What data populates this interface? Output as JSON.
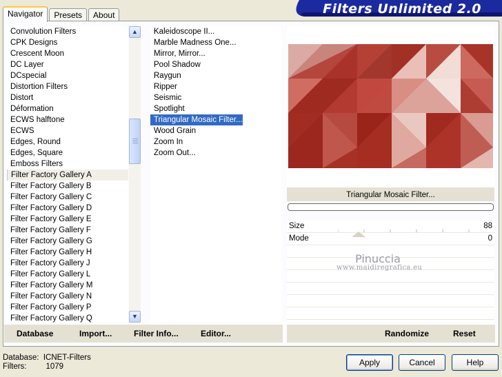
{
  "tabs": [
    "Navigator",
    "Presets",
    "About"
  ],
  "banner_title": "Filters Unlimited 2.0",
  "categories": [
    "Convolution Filters",
    "CPK Designs",
    "Crescent Moon",
    "DC Layer",
    "DCspecial",
    "Distortion Filters",
    "Distort",
    "Déformation",
    "ECWS halftone",
    "ECWS",
    "Edges, Round",
    "Edges, Square",
    "Emboss Filters",
    "Filter Factory Gallery A",
    "Filter Factory Gallery B",
    "Filter Factory Gallery C",
    "Filter Factory Gallery D",
    "Filter Factory Gallery E",
    "Filter Factory Gallery F",
    "Filter Factory Gallery G",
    "Filter Factory Gallery H",
    "Filter Factory Gallery J",
    "Filter Factory Gallery L",
    "Filter Factory Gallery M",
    "Filter Factory Gallery N",
    "Filter Factory Gallery P",
    "Filter Factory Gallery Q"
  ],
  "selected_category": "Filter Factory Gallery A",
  "filters": [
    "Kaleidoscope II...",
    "Marble Madness One...",
    "Mirror, Mirror...",
    "Pool Shadow",
    "Raygun",
    "Ripper",
    "Seismic",
    "Spotlight",
    "Triangular Mosaic Filter...",
    "Wood Grain",
    "Zoom In",
    "Zoom Out..."
  ],
  "selected_filter": "Triangular Mosaic Filter...",
  "preview": {
    "filter_name": "Triangular Mosaic Filter..."
  },
  "params": [
    {
      "label": "Size",
      "value": "88"
    },
    {
      "label": "Mode",
      "value": "0"
    }
  ],
  "watermark": {
    "line1": "Pinuccia",
    "line2": "www.maidiregrafica.eu"
  },
  "left_buttons": [
    "Database",
    "Import...",
    "Filter Info...",
    "Editor..."
  ],
  "right_buttons": [
    "Randomize",
    "Reset"
  ],
  "db": {
    "label": "Database:",
    "value": "ICNET-Filters",
    "filters_label": "Filters:",
    "filters_value": "1079"
  },
  "dialog_buttons": {
    "apply": "Apply",
    "cancel": "Cancel",
    "help": "Help"
  },
  "colors": {
    "banner": "#1c2aa0",
    "selection": "#316ac5",
    "mosaic_dark": "#9e2a20",
    "mosaic_light": "#f1dcd6"
  }
}
